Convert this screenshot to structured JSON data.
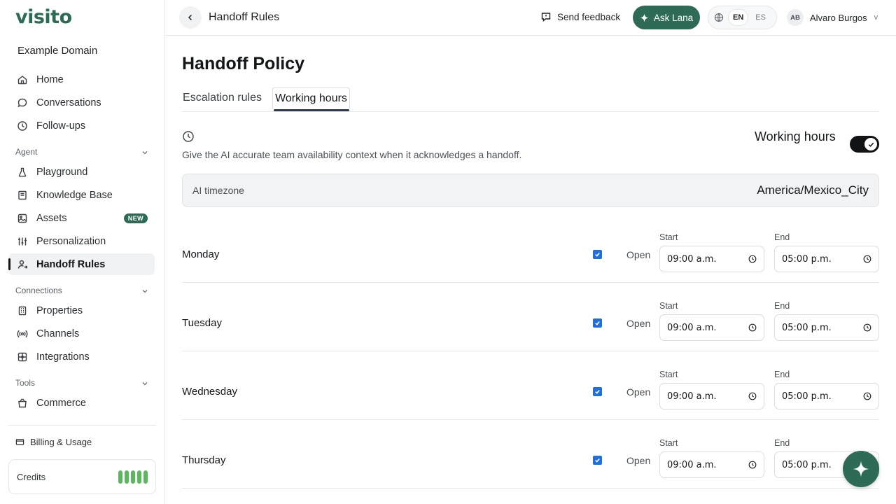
{
  "app": {
    "logo": "visito",
    "workspace": "Example Domain"
  },
  "sidebar": {
    "top_items": [
      {
        "label": "Home",
        "icon": "home-icon"
      },
      {
        "label": "Conversations",
        "icon": "chat-bubble-icon"
      },
      {
        "label": "Follow-ups",
        "icon": "clock-icon"
      }
    ],
    "agent_section": "Agent",
    "agent_items": [
      {
        "label": "Playground",
        "icon": "flask-icon"
      },
      {
        "label": "Knowledge Base",
        "icon": "book-icon"
      },
      {
        "label": "Assets",
        "icon": "image-icon",
        "badge": "NEW"
      },
      {
        "label": "Personalization",
        "icon": "sliders-icon"
      },
      {
        "label": "Handoff Rules",
        "icon": "user-handoff-icon",
        "active": true
      }
    ],
    "connections_section": "Connections",
    "connection_items": [
      {
        "label": "Properties",
        "icon": "building-icon"
      },
      {
        "label": "Channels",
        "icon": "broadcast-icon"
      },
      {
        "label": "Integrations",
        "icon": "puzzle-icon"
      }
    ],
    "tools_section": "Tools",
    "tool_items": [
      {
        "label": "Commerce",
        "icon": "shopping-bag-icon"
      }
    ],
    "billing": "Billing & Usage",
    "credits": "Credits"
  },
  "header": {
    "title": "Handoff Rules",
    "feedback": "Send feedback",
    "ask": "Ask Lana",
    "lang_en": "EN",
    "lang_es": "ES",
    "user_initials": "AB",
    "user_name": "Alvaro Burgos",
    "caret": "v"
  },
  "main": {
    "heading": "Handoff Policy",
    "tabs": [
      {
        "label": "Escalation rules"
      },
      {
        "label": "Working hours",
        "active": true
      }
    ],
    "description": "Give the AI accurate team availability context when it acknowledges a handoff.",
    "working_hours_label": "Working hours",
    "working_hours_enabled": true,
    "timezone_label": "AI timezone",
    "timezone_value": "America/Mexico_City",
    "open_label": "Open",
    "start_label": "Start",
    "end_label": "End",
    "days": [
      {
        "name": "Monday",
        "open": true,
        "start": "09:00 a.m.",
        "end": "05:00 p.m."
      },
      {
        "name": "Tuesday",
        "open": true,
        "start": "09:00 a.m.",
        "end": "05:00 p.m."
      },
      {
        "name": "Wednesday",
        "open": true,
        "start": "09:00 a.m.",
        "end": "05:00 p.m."
      },
      {
        "name": "Thursday",
        "open": true,
        "start": "09:00 a.m.",
        "end": "05:00 p.m."
      }
    ]
  },
  "colors": {
    "brand": "#2e6b57",
    "checkbox": "#1f6fde",
    "credits": "#5cb85c"
  }
}
